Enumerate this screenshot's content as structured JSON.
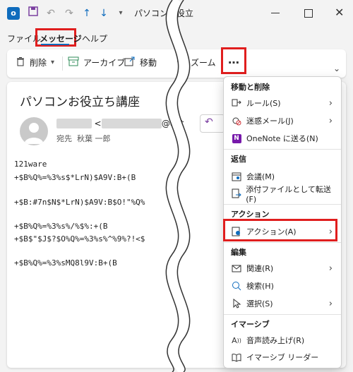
{
  "titlebar": {
    "title": "パソコンお役立"
  },
  "tabs": [
    {
      "label": "ファイル"
    },
    {
      "label": "メッセージ"
    },
    {
      "label": "ヘルプ"
    }
  ],
  "ribbon": {
    "delete_label": "削除",
    "archive_label": "アーカイブ",
    "move_label": "移動",
    "zoom_label": "ズーム",
    "more_label": "…"
  },
  "message": {
    "subject": "パソコンお役立ち講座",
    "sender_suffix": "@out",
    "to_label": "宛先",
    "to_name": "秋葉 一郎",
    "body": [
      "121ware",
      "+$B%Q%=%3%s$*LrN)$A9V:B+(B",
      "+$B:#7n$N$*LrN)$A9V:B$O!\"%Q%",
      "+$B%Q%=%3%s%/%$%:+(B",
      "+$B$\"$J$?$O%Q%=%3%s%^%9%?!<$",
      "+$B%Q%=%3%sMQ8l9V:B+(B"
    ]
  },
  "menu": {
    "sections": [
      {
        "header": "移動と削除",
        "items": [
          {
            "label": "ルール(S)",
            "has_sub": true
          },
          {
            "label": "迷惑メール(J)",
            "has_sub": true
          },
          {
            "label": "OneNote に送る(N)",
            "has_sub": false
          }
        ]
      },
      {
        "header": "返信",
        "items": [
          {
            "label": "会議(M)",
            "has_sub": false
          },
          {
            "label": "添付ファイルとして転送(F)",
            "has_sub": false
          }
        ]
      },
      {
        "header": "アクション",
        "items": [
          {
            "label": "アクション(A)",
            "has_sub": true
          }
        ]
      },
      {
        "header": "編集",
        "items": [
          {
            "label": "関連(R)",
            "has_sub": true
          },
          {
            "label": "検索(H)",
            "has_sub": false
          },
          {
            "label": "選択(S)",
            "has_sub": true
          }
        ]
      },
      {
        "header": "イマーシブ",
        "items": [
          {
            "label": "音声読み上げ(R)",
            "has_sub": false
          },
          {
            "label": "イマーシブ リーダー",
            "has_sub": false
          }
        ]
      }
    ]
  },
  "colors": {
    "highlight": "#e01e1e",
    "accent": "#0f6cbd"
  }
}
